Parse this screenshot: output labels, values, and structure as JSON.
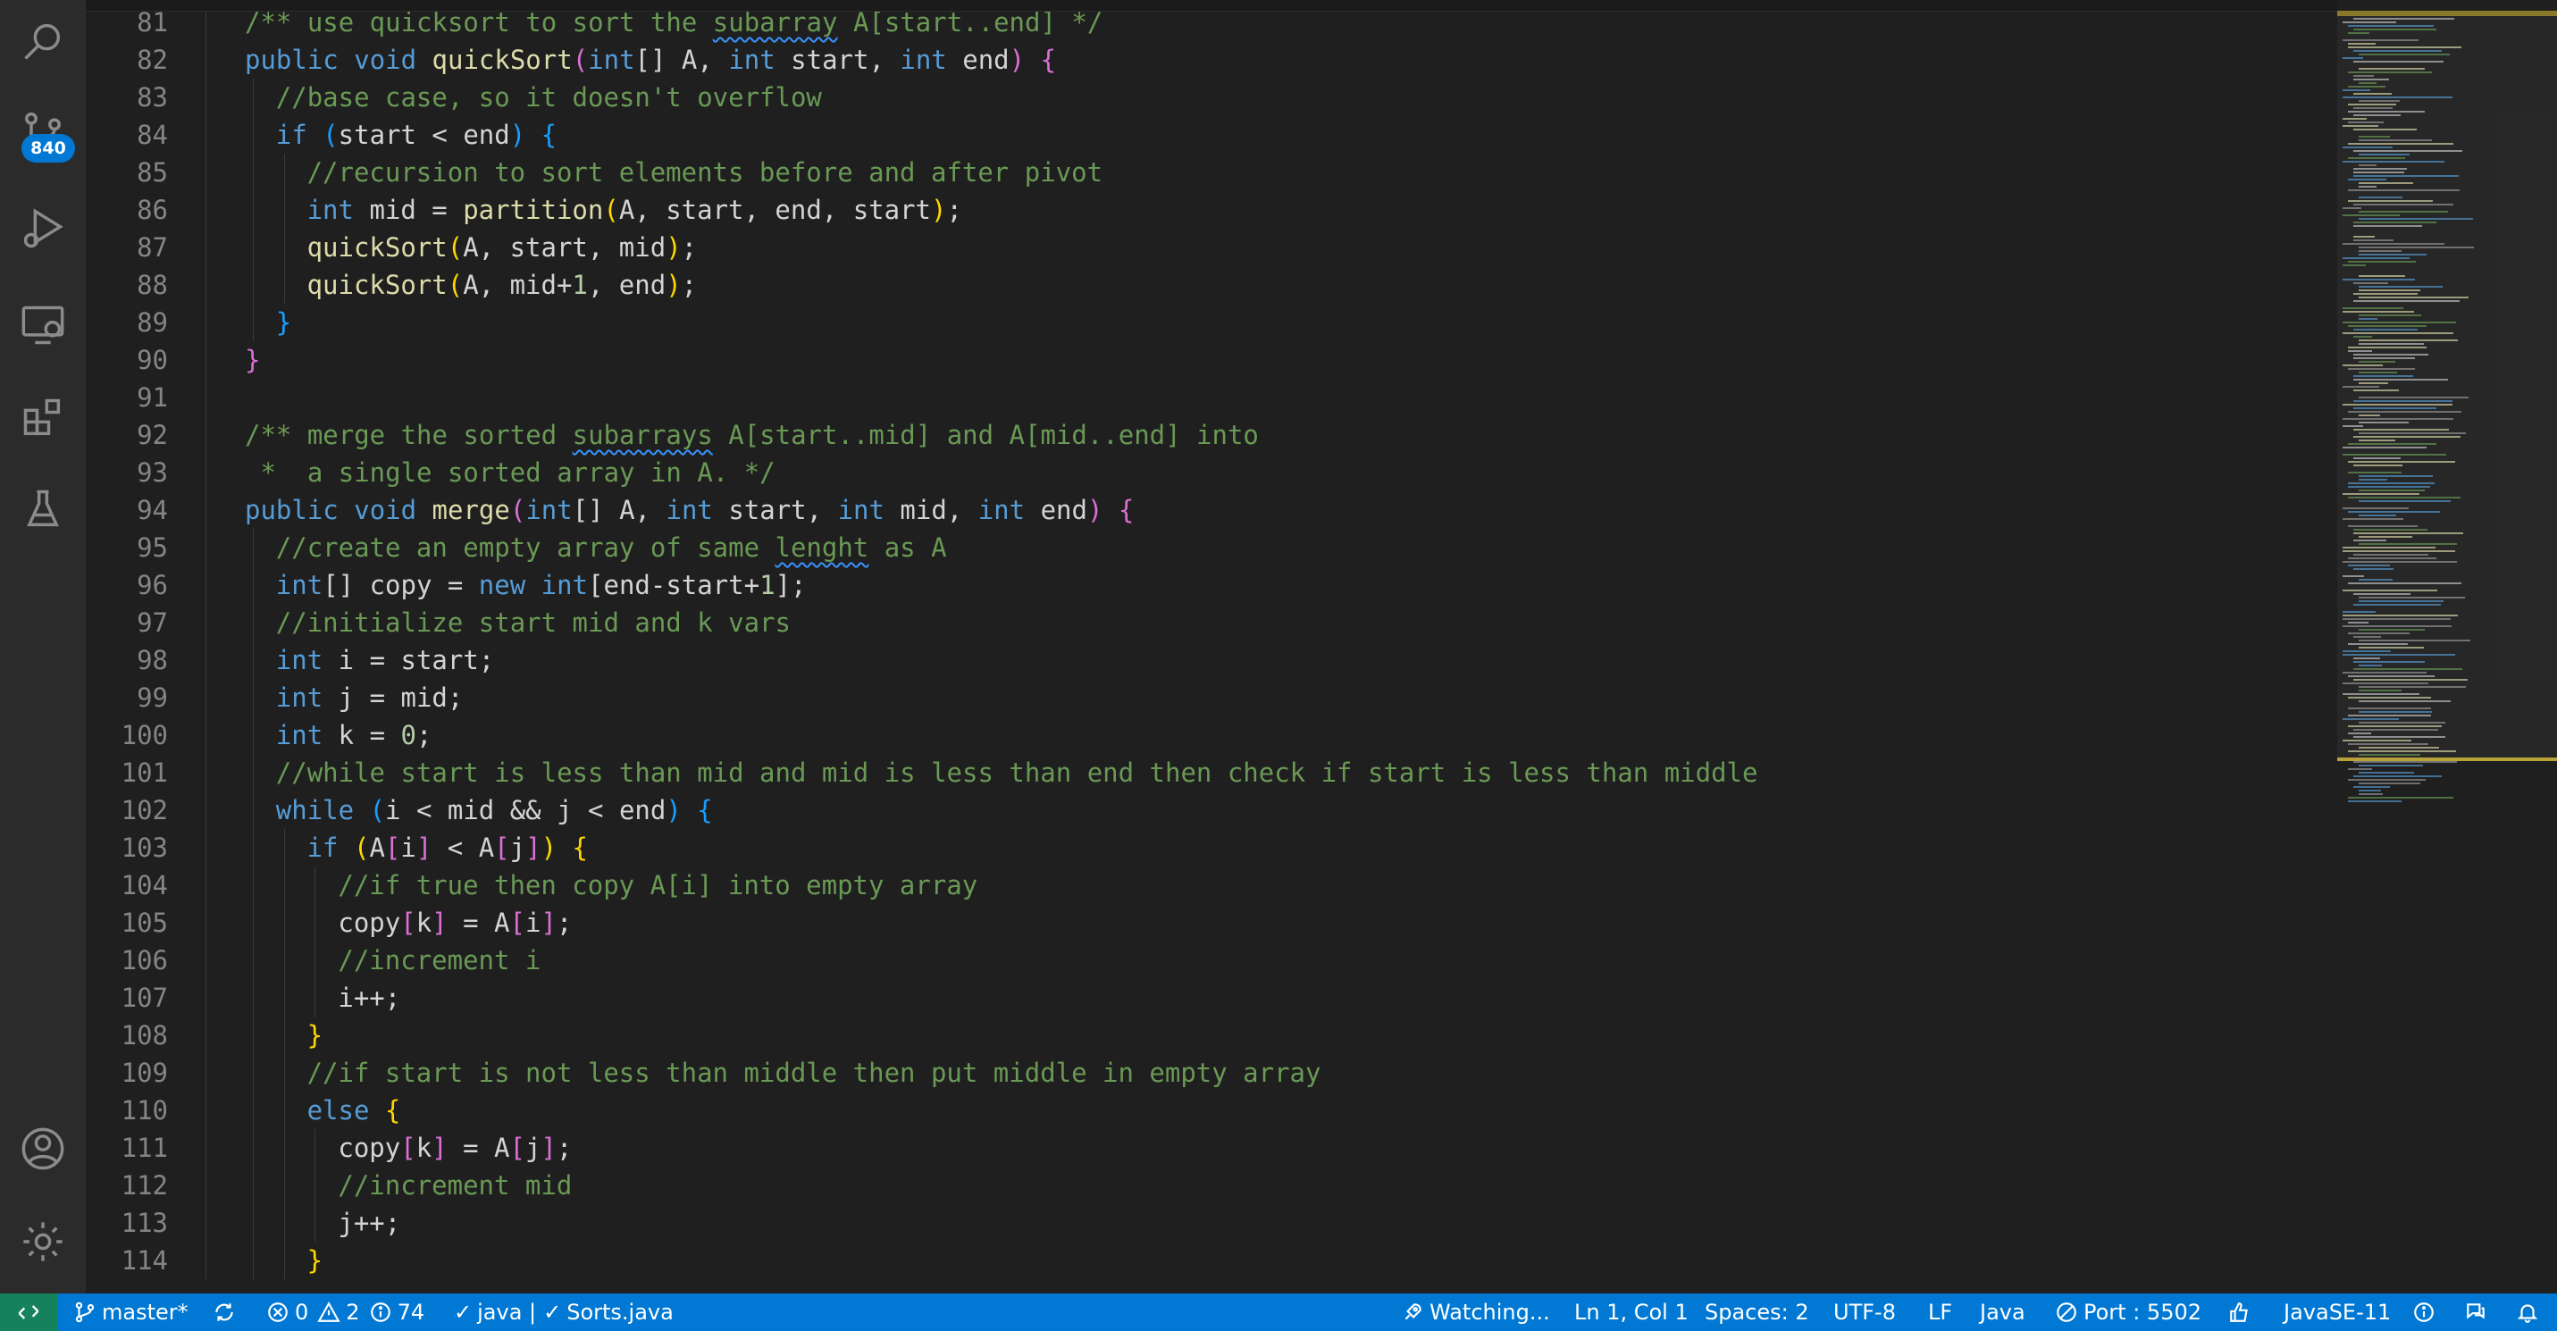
{
  "activity_bar": {
    "scm_badge": "840",
    "icons": [
      "search-icon",
      "source-control-icon",
      "run-debug-icon",
      "remote-explorer-icon",
      "extensions-icon",
      "testing-icon",
      "account-icon",
      "settings-gear-icon"
    ]
  },
  "colors": {
    "keyword": "#569cd6",
    "function": "#dcdcaa",
    "comment": "#6a9955",
    "number": "#b5cea8",
    "bracket_1": "#ffd700",
    "bracket_2": "#da70d6",
    "bracket_3": "#179fff",
    "status_bar": "#0078d4",
    "remote_button": "#16825d"
  },
  "editor": {
    "lines": [
      {
        "n": "81",
        "indent": 0,
        "tokens": [
          [
            "cm",
            "/** use quicksort to sort the "
          ],
          [
            "cm squig",
            "subarray"
          ],
          [
            "cm",
            " A[start..end] */"
          ]
        ]
      },
      {
        "n": "82",
        "indent": 0,
        "tokens": [
          [
            "kw",
            "public"
          ],
          [
            "",
            " "
          ],
          [
            "kw",
            "void"
          ],
          [
            "",
            " "
          ],
          [
            "fn",
            "quickSort"
          ],
          [
            "b2",
            "("
          ],
          [
            "ty",
            "int"
          ],
          [
            "",
            "[] A, "
          ],
          [
            "ty",
            "int"
          ],
          [
            "",
            " start, "
          ],
          [
            "ty",
            "int"
          ],
          [
            "",
            " end"
          ],
          [
            "b2",
            ")"
          ],
          [
            "",
            " "
          ],
          [
            "b2",
            "{"
          ]
        ]
      },
      {
        "n": "83",
        "indent": 1,
        "tokens": [
          [
            "cm",
            "//base case, so it doesn't overflow"
          ]
        ]
      },
      {
        "n": "84",
        "indent": 1,
        "tokens": [
          [
            "kw",
            "if"
          ],
          [
            "",
            " "
          ],
          [
            "b3",
            "("
          ],
          [
            "",
            "start < end"
          ],
          [
            "b3",
            ")"
          ],
          [
            "",
            " "
          ],
          [
            "b3",
            "{"
          ]
        ]
      },
      {
        "n": "85",
        "indent": 2,
        "tokens": [
          [
            "cm",
            "//recursion to sort elements before and after pivot"
          ]
        ]
      },
      {
        "n": "86",
        "indent": 2,
        "tokens": [
          [
            "ty",
            "int"
          ],
          [
            "",
            " mid = "
          ],
          [
            "fn",
            "partition"
          ],
          [
            "b1",
            "("
          ],
          [
            "",
            "A, start, end, start"
          ],
          [
            "b1",
            ")"
          ],
          [
            "",
            ";"
          ]
        ]
      },
      {
        "n": "87",
        "indent": 2,
        "tokens": [
          [
            "fn",
            "quickSort"
          ],
          [
            "b1",
            "("
          ],
          [
            "",
            "A, start, mid"
          ],
          [
            "b1",
            ")"
          ],
          [
            "",
            ";"
          ]
        ]
      },
      {
        "n": "88",
        "indent": 2,
        "tokens": [
          [
            "fn",
            "quickSort"
          ],
          [
            "b1",
            "("
          ],
          [
            "",
            "A, mid+"
          ],
          [
            "nu",
            "1"
          ],
          [
            "",
            ", end"
          ],
          [
            "b1",
            ")"
          ],
          [
            "",
            ";"
          ]
        ]
      },
      {
        "n": "89",
        "indent": 1,
        "tokens": [
          [
            "b3",
            "}"
          ]
        ]
      },
      {
        "n": "90",
        "indent": 0,
        "tokens": [
          [
            "b2",
            "}"
          ]
        ]
      },
      {
        "n": "91",
        "indent": 0,
        "tokens": []
      },
      {
        "n": "92",
        "indent": 0,
        "tokens": [
          [
            "cm",
            "/** merge the sorted "
          ],
          [
            "cm squig",
            "subarrays"
          ],
          [
            "cm",
            " A[start..mid] and A[mid..end] into"
          ]
        ]
      },
      {
        "n": "93",
        "indent": 0,
        "tokens": [
          [
            "cm",
            " *  a single sorted array in A. */"
          ]
        ]
      },
      {
        "n": "94",
        "indent": 0,
        "tokens": [
          [
            "kw",
            "public"
          ],
          [
            "",
            " "
          ],
          [
            "kw",
            "void"
          ],
          [
            "",
            " "
          ],
          [
            "fn",
            "merge"
          ],
          [
            "b2",
            "("
          ],
          [
            "ty",
            "int"
          ],
          [
            "",
            "[] A, "
          ],
          [
            "ty",
            "int"
          ],
          [
            "",
            " start, "
          ],
          [
            "ty",
            "int"
          ],
          [
            "",
            " mid, "
          ],
          [
            "ty",
            "int"
          ],
          [
            "",
            " end"
          ],
          [
            "b2",
            ")"
          ],
          [
            "",
            " "
          ],
          [
            "b2",
            "{"
          ]
        ]
      },
      {
        "n": "95",
        "indent": 1,
        "tokens": [
          [
            "cm",
            "//create an empty array of same "
          ],
          [
            "cm squig",
            "lenght"
          ],
          [
            "cm",
            " as A"
          ]
        ]
      },
      {
        "n": "96",
        "indent": 1,
        "tokens": [
          [
            "ty",
            "int"
          ],
          [
            "",
            "[] copy = "
          ],
          [
            "kw",
            "new"
          ],
          [
            "",
            " "
          ],
          [
            "ty",
            "int"
          ],
          [
            "",
            "[end-start+"
          ],
          [
            "nu",
            "1"
          ],
          [
            "",
            "];"
          ]
        ]
      },
      {
        "n": "97",
        "indent": 1,
        "tokens": [
          [
            "cm",
            "//initialize start mid and k vars"
          ]
        ]
      },
      {
        "n": "98",
        "indent": 1,
        "tokens": [
          [
            "ty",
            "int"
          ],
          [
            "",
            " i = start;"
          ]
        ]
      },
      {
        "n": "99",
        "indent": 1,
        "tokens": [
          [
            "ty",
            "int"
          ],
          [
            "",
            " j = mid;"
          ]
        ]
      },
      {
        "n": "100",
        "indent": 1,
        "tokens": [
          [
            "ty",
            "int"
          ],
          [
            "",
            " k = "
          ],
          [
            "nu",
            "0"
          ],
          [
            "",
            ";"
          ]
        ]
      },
      {
        "n": "101",
        "indent": 1,
        "tokens": [
          [
            "cm",
            "//while start is less than mid and mid is less than end then check if start is less than middle"
          ]
        ]
      },
      {
        "n": "102",
        "indent": 1,
        "tokens": [
          [
            "kw",
            "while"
          ],
          [
            "",
            " "
          ],
          [
            "b3",
            "("
          ],
          [
            "",
            "i < mid && j < end"
          ],
          [
            "b3",
            ")"
          ],
          [
            "",
            " "
          ],
          [
            "b3",
            "{"
          ]
        ]
      },
      {
        "n": "103",
        "indent": 2,
        "tokens": [
          [
            "kw",
            "if"
          ],
          [
            "",
            " "
          ],
          [
            "b1",
            "("
          ],
          [
            "",
            "A"
          ],
          [
            "b2",
            "["
          ],
          [
            "",
            "i"
          ],
          [
            "b2",
            "]"
          ],
          [
            "",
            " < A"
          ],
          [
            "b2",
            "["
          ],
          [
            "",
            "j"
          ],
          [
            "b2",
            "]"
          ],
          [
            "b1",
            ")"
          ],
          [
            "",
            " "
          ],
          [
            "b1",
            "{"
          ]
        ]
      },
      {
        "n": "104",
        "indent": 3,
        "tokens": [
          [
            "cm",
            "//if true then copy A[i] into empty array"
          ]
        ]
      },
      {
        "n": "105",
        "indent": 3,
        "tokens": [
          [
            "",
            "copy"
          ],
          [
            "b2",
            "["
          ],
          [
            "",
            "k"
          ],
          [
            "b2",
            "]"
          ],
          [
            "",
            " = A"
          ],
          [
            "b2",
            "["
          ],
          [
            "",
            "i"
          ],
          [
            "b2",
            "]"
          ],
          [
            "",
            ";"
          ]
        ]
      },
      {
        "n": "106",
        "indent": 3,
        "tokens": [
          [
            "cm",
            "//increment i"
          ]
        ]
      },
      {
        "n": "107",
        "indent": 3,
        "tokens": [
          [
            "",
            "i++;"
          ]
        ]
      },
      {
        "n": "108",
        "indent": 2,
        "tokens": [
          [
            "b1",
            "}"
          ]
        ]
      },
      {
        "n": "109",
        "indent": 2,
        "tokens": [
          [
            "cm",
            "//if start is not less than middle then put middle in empty array"
          ]
        ]
      },
      {
        "n": "110",
        "indent": 2,
        "tokens": [
          [
            "kw",
            "else"
          ],
          [
            "",
            " "
          ],
          [
            "b1",
            "{"
          ]
        ]
      },
      {
        "n": "111",
        "indent": 3,
        "tokens": [
          [
            "",
            "copy"
          ],
          [
            "b2",
            "["
          ],
          [
            "",
            "k"
          ],
          [
            "b2",
            "]"
          ],
          [
            "",
            " = A"
          ],
          [
            "b2",
            "["
          ],
          [
            "",
            "j"
          ],
          [
            "b2",
            "]"
          ],
          [
            "",
            ";"
          ]
        ]
      },
      {
        "n": "112",
        "indent": 3,
        "tokens": [
          [
            "cm",
            "//increment mid"
          ]
        ]
      },
      {
        "n": "113",
        "indent": 3,
        "tokens": [
          [
            "",
            "j++;"
          ]
        ]
      },
      {
        "n": "114",
        "indent": 2,
        "tokens": [
          [
            "b1",
            "}"
          ]
        ]
      }
    ]
  },
  "status_bar": {
    "branch": "master*",
    "errors": "0",
    "warnings": "2",
    "infos": "74",
    "java_status": "java | ",
    "file_status": "Sorts.java",
    "watching": "Watching...",
    "cursor": "Ln 1, Col 1",
    "spaces": "Spaces: 2",
    "encoding": "UTF-8",
    "eol": "LF",
    "language": "Java",
    "port": "Port : 5502",
    "runtime": "JavaSE-11"
  }
}
